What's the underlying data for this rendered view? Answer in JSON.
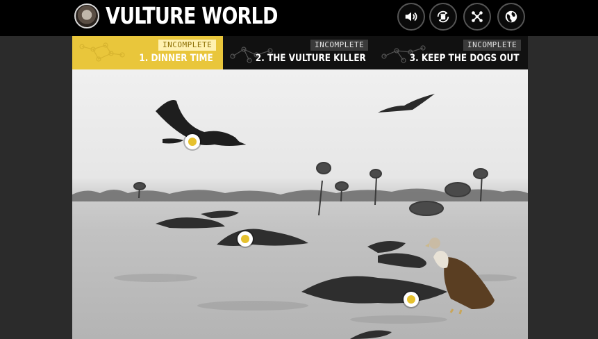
{
  "app": {
    "title": "VULTURE WORLD"
  },
  "toolbar": {
    "buttons": [
      {
        "name": "sound-button",
        "icon": "speaker-icon"
      },
      {
        "name": "recycle-button",
        "icon": "recycle-bin-icon"
      },
      {
        "name": "network-button",
        "icon": "network-icon"
      },
      {
        "name": "globe-button",
        "icon": "globe-icon"
      }
    ]
  },
  "tabs": [
    {
      "status": "INCOMPLETE",
      "label": "1. DINNER TIME",
      "active": true
    },
    {
      "status": "INCOMPLETE",
      "label": "2. THE VULTURE KILLER",
      "active": false
    },
    {
      "status": "INCOMPLETE",
      "label": "3. KEEP THE DOGS OUT",
      "active": false
    }
  ],
  "colors": {
    "accent": "#e9c63b",
    "topbar": "#000000",
    "background": "#2b2b2b"
  }
}
